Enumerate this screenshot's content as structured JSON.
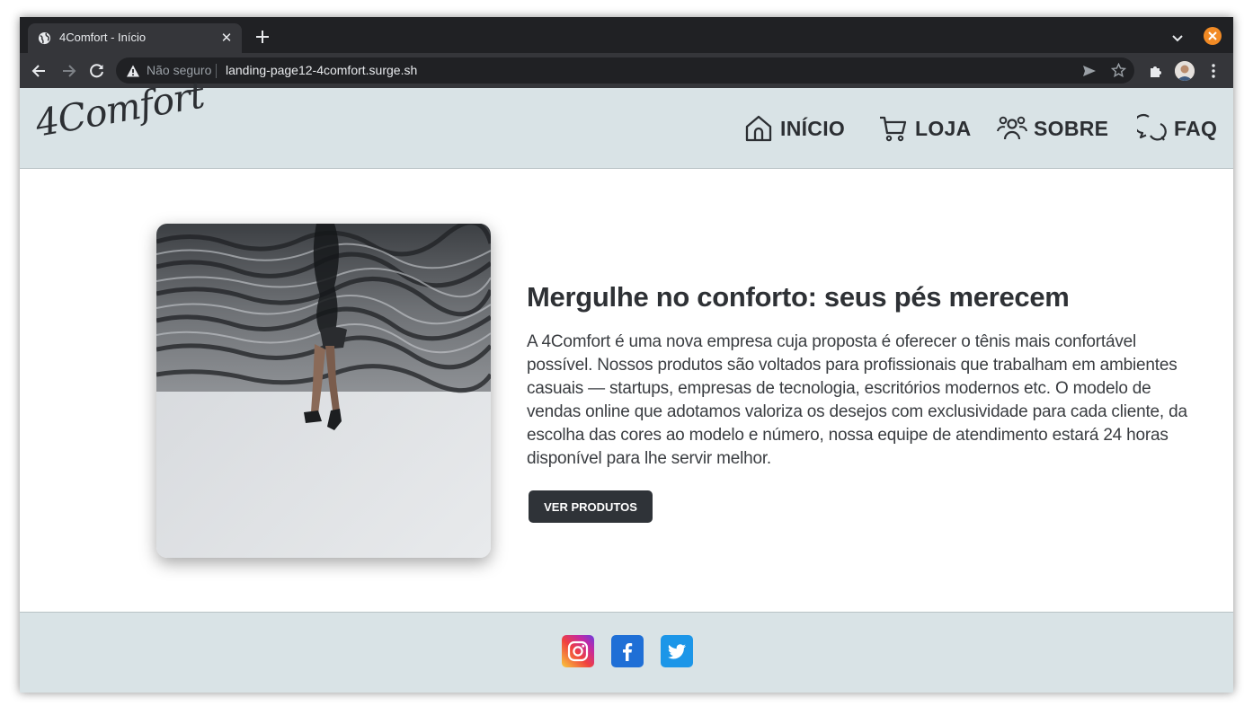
{
  "browser": {
    "tab_title": "4Comfort - Início",
    "security_label": "Não seguro",
    "url": "landing-page12-4comfort.surge.sh"
  },
  "site": {
    "logo": "4Comfort",
    "nav": [
      {
        "label": "INÍCIO",
        "icon": "home-icon"
      },
      {
        "label": "LOJA",
        "icon": "cart-icon"
      },
      {
        "label": "SOBRE",
        "icon": "users-icon"
      },
      {
        "label": "FAQ",
        "icon": "chat-icon"
      }
    ]
  },
  "hero": {
    "headline": "Mergulhe no conforto: seus pés merecem",
    "paragraph": "A 4Comfort é uma nova empresa cuja proposta é oferecer o tênis mais confortável possível. Nossos produtos são voltados para profissionais que trabalham em ambientes casuais — startups, empresas de tecnologia, escritórios modernos etc. O modelo de vendas online que adotamos valoriza os desejos com exclusividade para cada cliente, da escolha das cores ao modelo e número, nossa equipe de atendimento estará 24 horas disponível para lhe servir melhor.",
    "cta_label": "VER PRODUTOS"
  },
  "footer": {
    "social": [
      "instagram-icon",
      "facebook-icon",
      "twitter-icon"
    ]
  },
  "colors": {
    "header_bg": "#d9e3e6",
    "text_dark": "#2c2f33",
    "button_bg": "#2f3338"
  }
}
